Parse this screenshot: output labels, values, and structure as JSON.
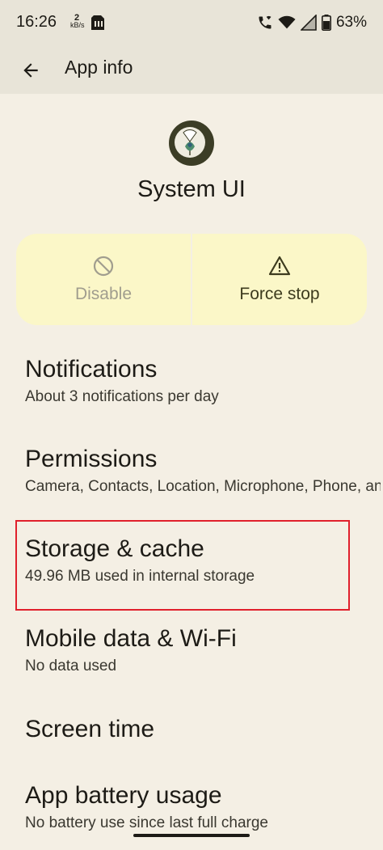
{
  "status_bar": {
    "time": "16:26",
    "net_speed_value": "2",
    "net_speed_unit": "kB/s",
    "battery_percent": "63%",
    "icons": [
      "sim-card-icon",
      "wifi-calling-icon",
      "wifi-icon",
      "cellular-signal-icon",
      "battery-icon"
    ]
  },
  "app_bar": {
    "back_icon": "arrow-back-icon",
    "title": "App info"
  },
  "app": {
    "icon": "system-ui-app-icon",
    "name": "System UI"
  },
  "actions": {
    "disable": {
      "label": "Disable",
      "icon": "disable-icon",
      "enabled": false
    },
    "force_stop": {
      "label": "Force stop",
      "icon": "warning-icon",
      "enabled": true
    }
  },
  "preferences": [
    {
      "title": "Notifications",
      "summary": "About 3 notifications per day"
    },
    {
      "title": "Permissions",
      "summary": "Camera, Contacts, Location, Microphone, Phone, and SMS"
    },
    {
      "title": "Storage & cache",
      "summary": "49.96 MB used in internal storage"
    },
    {
      "title": "Mobile data & Wi-Fi",
      "summary": "No data used"
    },
    {
      "title": "Screen time",
      "summary": ""
    },
    {
      "title": "App battery usage",
      "summary": "No battery use since last full charge"
    }
  ],
  "colors": {
    "background": "#f4efe4",
    "app_bar": "#e8e4d8",
    "action_bar": "#fbf7c8",
    "highlight": "#e0202c"
  }
}
